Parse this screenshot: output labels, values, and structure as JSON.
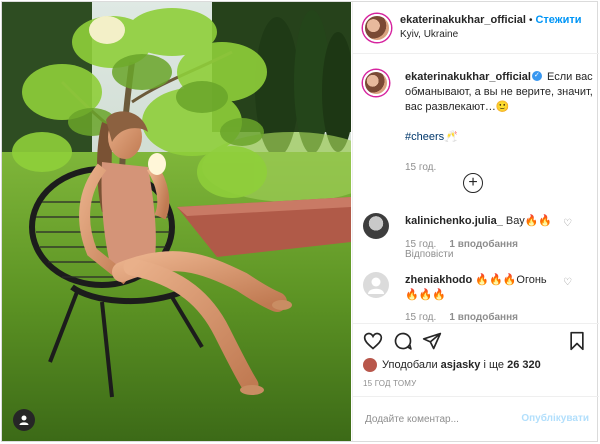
{
  "post": {
    "username": "ekaterinakukhar_official",
    "follow_label": "Стежити",
    "location": "Kyiv, Ukraine"
  },
  "caption": {
    "username": "ekaterinakukhar_official",
    "text": "Если вас обманывают, а вы не верите, значит, вас развлекают…🙂",
    "hashtag": "#cheers🥂",
    "time": "15 год."
  },
  "comments": [
    {
      "username": "kalinichenko.julia_",
      "text": "Вау🔥🔥",
      "time": "15 год.",
      "likes": "1 вподобання",
      "replies": "Відповісти"
    },
    {
      "username": "zheniakhodo",
      "text": "🔥🔥🔥Огонь🔥🔥🔥",
      "time": "15 год.",
      "likes": "1 вподобання"
    }
  ],
  "likes": {
    "prefix": "Уподобали",
    "user": "asjasky",
    "suffix": "і ще",
    "count": "26 320"
  },
  "posted_time": "15 год тому",
  "add_comment": {
    "placeholder": "Додайте коментар...",
    "publish_label": "Опублікувати"
  },
  "colors": {
    "accent": "#0095f6",
    "publish_disabled": "#b2dffc",
    "secondary_text": "#8e8e8e"
  },
  "icons": [
    "user-tag-icon",
    "verified-badge-icon",
    "load-more-icon",
    "heart-icon",
    "comment-icon",
    "share-icon",
    "bookmark-icon"
  ]
}
